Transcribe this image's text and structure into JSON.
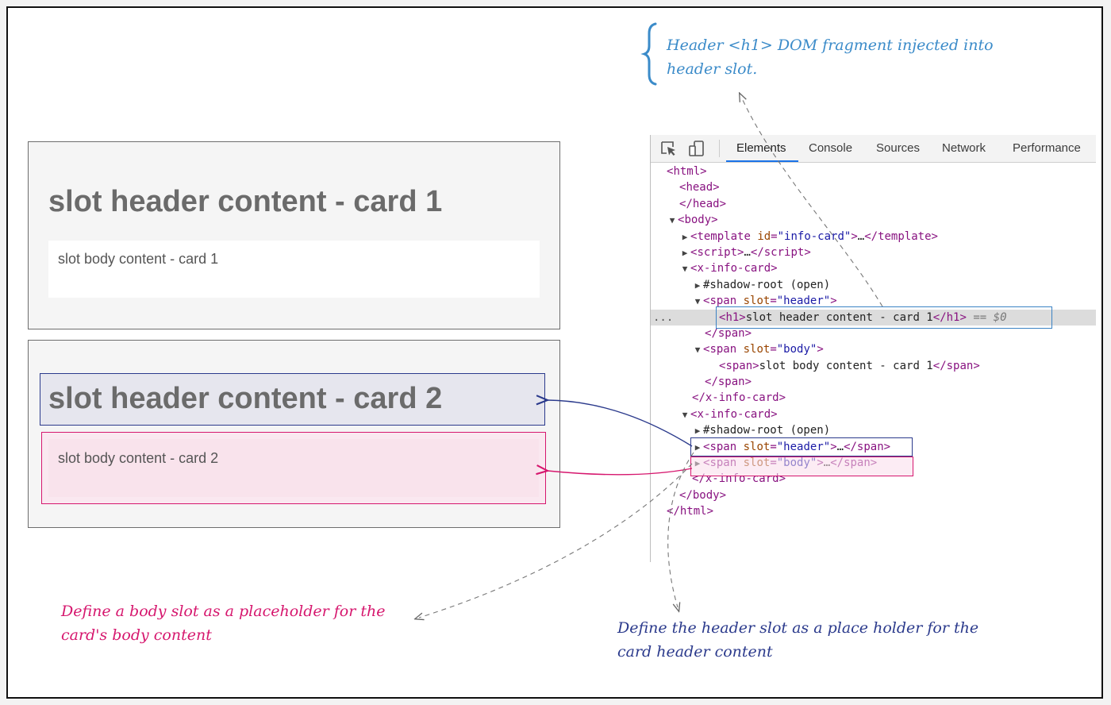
{
  "cards": {
    "card1": {
      "header": "slot header content - card 1",
      "body": "slot body content - card 1"
    },
    "card2": {
      "header": "slot header content - card 2",
      "body": "slot body content - card 2"
    }
  },
  "devtools": {
    "icons": [
      "inspect-element-icon",
      "device-toolbar-icon"
    ],
    "tabs": [
      "Elements",
      "Console",
      "Sources",
      "Network",
      "Performance"
    ],
    "active_tab": "Elements",
    "selected_marker": "...",
    "selected_suffix": "== $0",
    "tree": {
      "html_open": "html",
      "head_open": "head",
      "head_close": "/head",
      "body_open": "body",
      "template_tag": "template",
      "template_attr": "id",
      "template_val": "\"info-card\"",
      "template_close": "/template",
      "script_tag": "script",
      "script_close": "/script",
      "xinfo_tag": "x-info-card",
      "xinfo_close": "/x-info-card",
      "shadow_root": "#shadow-root (open)",
      "span_tag": "span",
      "span_close": "/span",
      "slot_attr": "slot",
      "header_val": "\"header\"",
      "body_val": "\"body\"",
      "h1_tag": "h1",
      "h1_close": "/h1",
      "h1_text": "slot header content - card 1",
      "span_body_text": "slot body content - card 1",
      "ellipsis": "…",
      "body_close": "/body",
      "html_close": "/html"
    }
  },
  "annotations": {
    "top_note": "Header <h1> DOM fragment injected into header slot.",
    "body_note": "Define a body slot as a placeholder for the card's body content",
    "header_note": "Define the header slot as a place holder for the card header content"
  },
  "colors": {
    "blue_note": "#3b8bc9",
    "pink": "#d6176e",
    "navy": "#2b3a8c",
    "tab_underline": "#1a73e8"
  }
}
